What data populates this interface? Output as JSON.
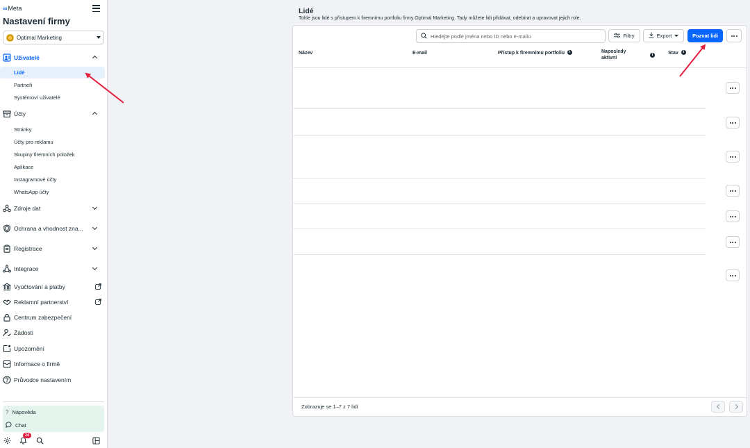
{
  "brand": {
    "logo_text": "Meta",
    "logo_glyph": "∞"
  },
  "app_title": "Nastavení firmy",
  "portfolio": {
    "name": "Optimal Marketing"
  },
  "sidebar": {
    "users": {
      "label": "Uživatelé",
      "items": [
        {
          "label": "Lidé",
          "active": true
        },
        {
          "label": "Partneři"
        },
        {
          "label": "Systémoví uživatelé"
        }
      ]
    },
    "accounts": {
      "label": "Účty",
      "items": [
        {
          "label": "Stránky"
        },
        {
          "label": "Účty pro reklamu"
        },
        {
          "label": "Skupiny firemních položek"
        },
        {
          "label": "Aplikace"
        },
        {
          "label": "Instagramové účty"
        },
        {
          "label": "WhatsApp účty"
        }
      ]
    },
    "data_sources": "Zdroje dat",
    "brand_safety": "Ochrana a vhodnost zna...",
    "registration": "Registrace",
    "integrations": "Integrace",
    "billing": "Vyúčtování a platby",
    "ad_partnerships": "Reklamní partnerství",
    "security_center": "Centrum zabezpečení",
    "requests": "Žádosti",
    "notifications": "Upozornění",
    "business_info": "Informace o firmě",
    "setup_guide": "Průvodce nastavením",
    "help": "Nápověda",
    "chat": "Chat",
    "notification_count": "24"
  },
  "main": {
    "title": "Lidé",
    "description": "Tohle jsou lidé s přístupem k firemnímu portfoliu firmy Optimal Marketing. Tady můžete lidi přidávat, odebírat a upravovat jejich role.",
    "search_placeholder": "Hledejte podle jména nebo ID nebo e-mailu",
    "filters_label": "Filtry",
    "export_label": "Export",
    "invite_label": "Pozvat lidi",
    "columns": {
      "name": "Název",
      "email": "E-mail",
      "access": "Přístup k firemnímu portfoliu",
      "last_active": "Naposledy aktivní",
      "status": "Stav"
    },
    "footer_text": "Zobrazuje se 1–7 z 7 lidí"
  },
  "colors": {
    "accent": "#0866ff",
    "annotation_arrow": "#e41e3f",
    "active_bg": "#e7f0fd",
    "help_bg": "#e6f4ee"
  }
}
